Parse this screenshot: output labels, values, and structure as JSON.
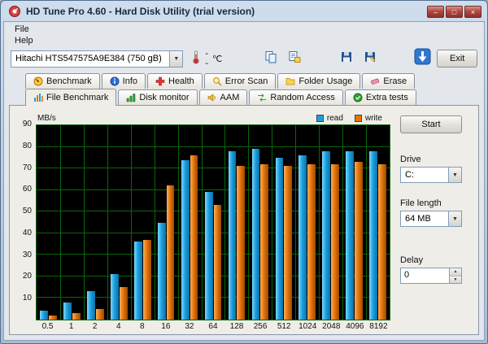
{
  "titlebar": {
    "title": "HD Tune Pro 4.60 - Hard Disk Utility (trial version)",
    "controls": {
      "minimize": "–",
      "maximize": "□",
      "close": "×"
    }
  },
  "menubar": {
    "items": [
      {
        "label": "File"
      },
      {
        "label": "Help"
      }
    ]
  },
  "toolbar": {
    "drive_combo_value": "Hitachi HTS547575A9E384 (750 gB)",
    "temperature_value": "--",
    "temperature_unit": "℃",
    "exit_label": "Exit"
  },
  "tabs_row1": [
    {
      "label": "Benchmark",
      "icon": "benchmark-icon"
    },
    {
      "label": "Info",
      "icon": "info-icon"
    },
    {
      "label": "Health",
      "icon": "health-icon"
    },
    {
      "label": "Error Scan",
      "icon": "error-scan-icon"
    },
    {
      "label": "Folder Usage",
      "icon": "folder-usage-icon"
    },
    {
      "label": "Erase",
      "icon": "erase-icon"
    }
  ],
  "tabs_row2": [
    {
      "label": "File Benchmark",
      "icon": "file-benchmark-icon",
      "active": true
    },
    {
      "label": "Disk monitor",
      "icon": "disk-monitor-icon"
    },
    {
      "label": "AAM",
      "icon": "aam-icon"
    },
    {
      "label": "Random Access",
      "icon": "random-access-icon"
    },
    {
      "label": "Extra tests",
      "icon": "extra-tests-icon"
    }
  ],
  "side_panel": {
    "start_label": "Start",
    "drive_label": "Drive",
    "drive_value": "C:",
    "file_length_label": "File length",
    "file_length_value": "64 MB",
    "delay_label": "Delay",
    "delay_value": "0"
  },
  "chart_data": {
    "type": "bar",
    "title": "",
    "ylabel": "MB/s",
    "xlabel": "",
    "ylim": [
      0,
      90
    ],
    "yticks": [
      90,
      80,
      70,
      60,
      50,
      40,
      30,
      20,
      10
    ],
    "grid": true,
    "grid_color": "#0a650a",
    "plot_background": "#000000",
    "legend_position": "top-right",
    "categories": [
      "0.5",
      "1",
      "2",
      "4",
      "8",
      "16",
      "32",
      "64",
      "128",
      "256",
      "512",
      "1024",
      "2048",
      "4096",
      "8192"
    ],
    "series": [
      {
        "name": "read",
        "color": "#1ba1e2",
        "values": [
          4,
          8,
          13,
          21,
          36,
          45,
          74,
          59,
          78,
          79,
          75,
          76,
          78,
          78,
          78
        ]
      },
      {
        "name": "write",
        "color": "#e8750a",
        "values": [
          2,
          3,
          5,
          15,
          37,
          62,
          76,
          53,
          71,
          72,
          71,
          72,
          72,
          73,
          72
        ]
      }
    ]
  }
}
